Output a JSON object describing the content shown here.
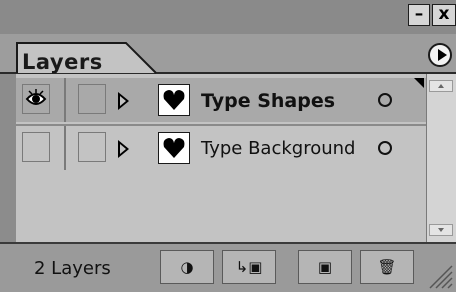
{
  "window": {
    "minimize_label": "–",
    "close_label": "x"
  },
  "panel": {
    "tab_label": "Layers",
    "menu_icon": "play-triangle-circle-icon"
  },
  "layers": [
    {
      "name": "Type Shapes",
      "selected": true,
      "visible": true,
      "thumbnail_icon": "heart-icon"
    },
    {
      "name": "Type Background",
      "selected": false,
      "visible": false,
      "thumbnail_icon": "heart-icon"
    }
  ],
  "footer": {
    "count_label": "2 Layers",
    "buttons": [
      {
        "icon": "make-clipping-mask-icon",
        "glyph": "◑"
      },
      {
        "icon": "create-sublayer-icon",
        "glyph": "↳▣"
      },
      {
        "icon": "new-layer-icon",
        "glyph": "▣"
      },
      {
        "icon": "trash-icon",
        "glyph": "🗑"
      }
    ]
  },
  "colors": {
    "selected_row": "#a9a9a9",
    "panel_bg": "#c3c3c3",
    "chrome": "#8c8c8c"
  }
}
